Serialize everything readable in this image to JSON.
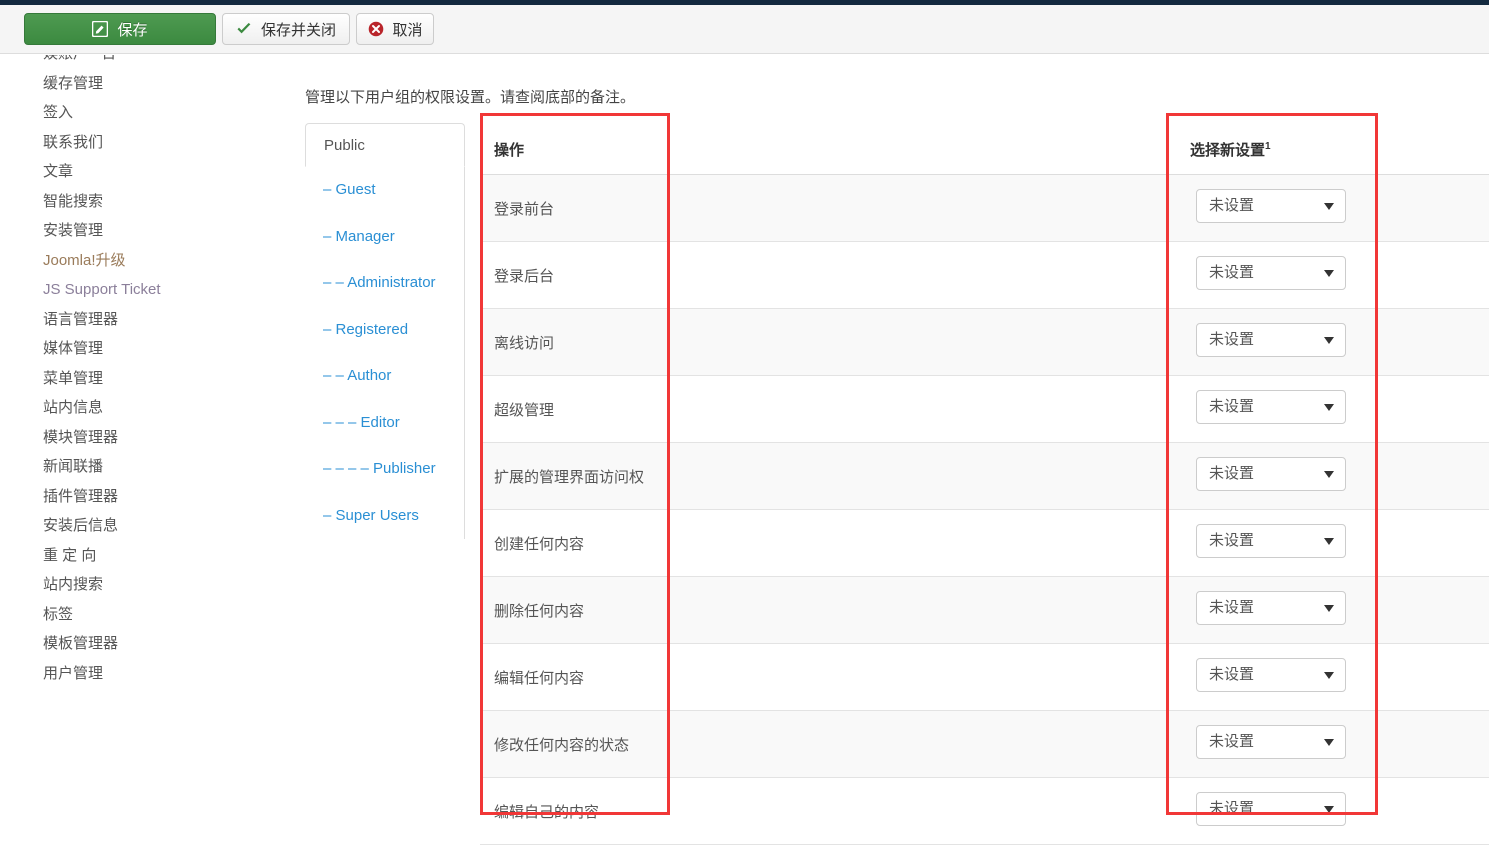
{
  "toolbar": {
    "save_label": "保存",
    "save_close_label": "保存并关闭",
    "cancel_label": "取消"
  },
  "sidebar": {
    "items": [
      {
        "label": "娱账户 - 台",
        "style": "plain"
      },
      {
        "label": "缓存管理",
        "style": "plain"
      },
      {
        "label": "签入",
        "style": "plain"
      },
      {
        "label": "联系我们",
        "style": "plain"
      },
      {
        "label": "文章",
        "style": "plain"
      },
      {
        "label": "智能搜索",
        "style": "plain"
      },
      {
        "label": "安装管理",
        "style": "plain"
      },
      {
        "label": "Joomla!升级",
        "style": "link"
      },
      {
        "label": "JS Support Ticket",
        "style": "link2"
      },
      {
        "label": "语言管理器",
        "style": "plain"
      },
      {
        "label": "媒体管理",
        "style": "plain"
      },
      {
        "label": "菜单管理",
        "style": "plain"
      },
      {
        "label": "站内信息",
        "style": "plain"
      },
      {
        "label": "模块管理器",
        "style": "plain"
      },
      {
        "label": "新闻联播",
        "style": "plain"
      },
      {
        "label": "插件管理器",
        "style": "plain"
      },
      {
        "label": "安装后信息",
        "style": "plain"
      },
      {
        "label": "重 定 向",
        "style": "plain"
      },
      {
        "label": "站内搜索",
        "style": "plain"
      },
      {
        "label": "标签",
        "style": "plain"
      },
      {
        "label": "模板管理器",
        "style": "plain"
      },
      {
        "label": "用户管理",
        "style": "plain"
      }
    ]
  },
  "main": {
    "description": "管理以下用户组的权限设置。请查阅底部的备注。",
    "group_tabs": {
      "active": "Public",
      "children": [
        "– Guest",
        "– Manager",
        "– – Administrator",
        "– Registered",
        "– – Author",
        "– – – Editor",
        "– – – – Publisher",
        "– Super Users"
      ]
    },
    "table": {
      "headers": {
        "action": "操作",
        "middle": "",
        "new_setting": "选择新设置",
        "new_setting_sup": "1",
        "calculated": ""
      },
      "rows": [
        {
          "action": "登录前台",
          "new_setting": "未设置"
        },
        {
          "action": "登录后台",
          "new_setting": "未设置"
        },
        {
          "action": "离线访问",
          "new_setting": "未设置"
        },
        {
          "action": "超级管理",
          "new_setting": "未设置"
        },
        {
          "action": "扩展的管理界面访问权",
          "new_setting": "未设置"
        },
        {
          "action": "创建任何内容",
          "new_setting": "未设置"
        },
        {
          "action": "删除任何内容",
          "new_setting": "未设置"
        },
        {
          "action": "编辑任何内容",
          "new_setting": "未设置"
        },
        {
          "action": "修改任何内容的状态",
          "new_setting": "未设置"
        },
        {
          "action": "编辑自己的内容",
          "new_setting": "未设置"
        }
      ]
    }
  },
  "colors": {
    "topbar": "#13293f",
    "save_green": "#3c8a40",
    "link_blue": "#2a8fd4",
    "annotation_red": "#f13737"
  }
}
